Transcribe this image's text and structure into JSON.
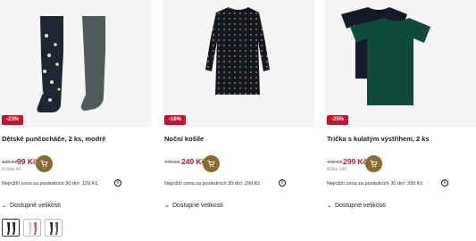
{
  "products": [
    {
      "badge": "-23%",
      "title": "Dětské punčocháče, 2 ks, modré",
      "old_price": "129 Kč",
      "new_price": "99 Kč",
      "sub_price": "Kč/pár 49",
      "lowest_text": "Nejnižší cena za posledních 30 dní: 129 Kč",
      "sizes_label": "Dostupné velikosti"
    },
    {
      "badge": "-16%",
      "title": "Noční košile",
      "old_price": "440 Kč",
      "new_price": "249 Kč",
      "sub_price": "",
      "lowest_text": "Nejnižší cena za posledních 30 dní: 299 Kč",
      "sizes_label": "Dostupné velikosti"
    },
    {
      "badge": "-25%",
      "title": "Trička s kulatým výstřihem, 2 ks",
      "old_price": "449 Kč",
      "new_price": "299 Kč",
      "sub_price": "Kč/ks 149",
      "lowest_text": "Nejnižší cena za posledních 30 dní: 399 Kč",
      "sizes_label": "Dostupné velikosti"
    }
  ],
  "icons": {
    "cart": "shopping-cart-icon",
    "info": "info-icon",
    "chevron": "chevron-down-icon"
  },
  "colors": {
    "discount_red": "#c8102e",
    "cart_gold": "#8a6a2e"
  }
}
